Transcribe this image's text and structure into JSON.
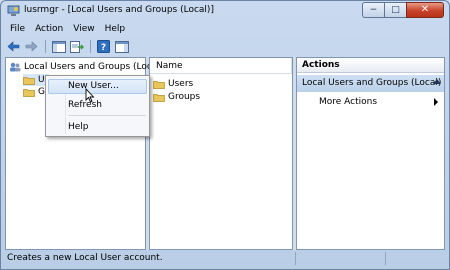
{
  "window": {
    "title": "lusrmgr - [Local Users and Groups (Local)]"
  },
  "caption_buttons": {
    "minimize": "−",
    "maximize": "□",
    "close": "✕"
  },
  "menu": {
    "items": [
      "File",
      "Action",
      "View",
      "Help"
    ]
  },
  "toolbar": {
    "icons": [
      "back-arrow-icon",
      "forward-arrow-icon",
      "show-hide-tree-icon",
      "export-list-icon",
      "help-icon",
      "show-hide-action-pane-icon"
    ]
  },
  "tree": {
    "root_label": "Local Users and Groups (Local)",
    "children": [
      {
        "label": "Users",
        "visible_text": "Us"
      },
      {
        "label": "Groups",
        "visible_text": "Gr"
      }
    ]
  },
  "list": {
    "column_header": "Name",
    "rows": [
      "Users",
      "Groups"
    ]
  },
  "actions": {
    "header": "Actions",
    "group_title": "Local Users and Groups (Local)",
    "more_actions": "More Actions"
  },
  "context_menu": {
    "items": [
      "New User...",
      "Refresh",
      "Help"
    ],
    "highlighted": "New User..."
  },
  "status": {
    "text": "Creates a new Local User account."
  },
  "colors": {
    "folder": "#e8c65a",
    "actions_group_bg": "#c6daf0",
    "close_button": "#c8432a"
  }
}
